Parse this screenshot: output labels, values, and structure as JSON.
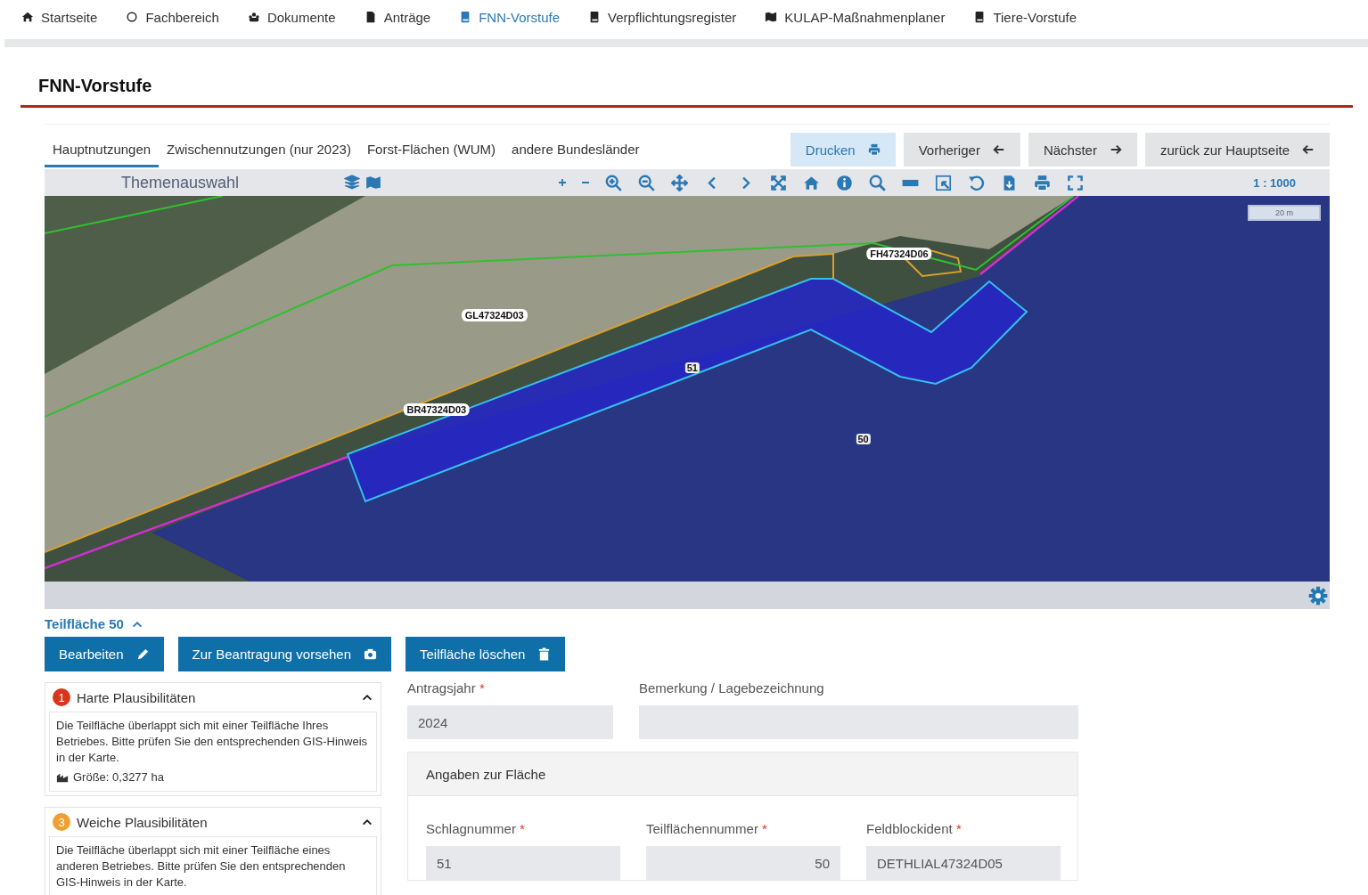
{
  "nav": [
    {
      "label": "Startseite",
      "selected": false
    },
    {
      "label": "Fachbereich",
      "selected": false
    },
    {
      "label": "Dokumente",
      "selected": false
    },
    {
      "label": "Anträge",
      "selected": false
    },
    {
      "label": "FNN-Vorstufe",
      "selected": true
    },
    {
      "label": "Verpflichtungsregister",
      "selected": false
    },
    {
      "label": "KULAP-Maßnahmenplaner",
      "selected": false
    },
    {
      "label": "Tiere-Vorstufe",
      "selected": false
    }
  ],
  "page_title": "FNN-Vorstufe",
  "tabs": [
    {
      "label": "Hauptnutzungen",
      "selected": true
    },
    {
      "label": "Zwischennutzungen (nur 2023)",
      "selected": false
    },
    {
      "label": "Forst-Flächen (WUM)",
      "selected": false
    },
    {
      "label": "andere Bundesländer",
      "selected": false
    }
  ],
  "header_buttons": [
    {
      "label": "Drucken",
      "kind": "print"
    },
    {
      "label": "Vorheriger",
      "kind": "prev"
    },
    {
      "label": "Nächster",
      "kind": "next"
    },
    {
      "label": "zurück zur Hauptseite",
      "kind": "back"
    }
  ],
  "map": {
    "theme_label": "Themenauswahl",
    "scale_ratio": "1 : 1000",
    "scale_bar": "20 m",
    "labels": [
      {
        "text": "GL47324D03",
        "kind": "field"
      },
      {
        "text": "BR47324D03",
        "kind": "field"
      },
      {
        "text": "FH47324D06",
        "kind": "field"
      },
      {
        "text": "51",
        "kind": "number"
      },
      {
        "text": "50",
        "kind": "number"
      }
    ]
  },
  "section": {
    "title": "Teilfläche 50",
    "expanded": true
  },
  "actions": [
    {
      "label": "Bearbeiten",
      "kind": "edit"
    },
    {
      "label": "Zur Beantragung vorsehen",
      "kind": "camera"
    },
    {
      "label": "Teilfläche löschen",
      "kind": "delete"
    }
  ],
  "checks": [
    {
      "count": "1",
      "title": "Harte Plausibilitäten",
      "color": "#d9351c",
      "expanded": true,
      "message": "Die Teilfläche überlappt sich mit einer Teilfläche Ihres Betriebes. Bitte prüfen Sie den entsprechenden GIS-Hinweis in der Karte.",
      "size": "Größe: 0,3277 ha"
    },
    {
      "count": "3",
      "title": "Weiche Plausibilitäten",
      "color": "#f0a030",
      "expanded": true,
      "message": "Die Teilfläche überlappt sich mit einer Teilfläche eines anderen Betriebes. Bitte prüfen Sie den entsprechenden GIS-Hinweis in der Karte."
    }
  ],
  "form": {
    "fields": [
      {
        "label": "Antragsjahr",
        "required_mark": "*",
        "value": "2024"
      },
      {
        "label": "Bemerkung / Lagebezeichnung"
      }
    ],
    "panel": {
      "title": "Angaben zur Fläche",
      "fields": [
        {
          "label": "Schlagnummer",
          "required_mark": "*",
          "value": "51"
        },
        {
          "label": "Teilflächennummer",
          "required_mark": "*",
          "value": "50",
          "kind": "number"
        },
        {
          "label": "Feldblockident",
          "required_mark": "*",
          "value": "DETHLIAL47324D05"
        }
      ]
    }
  }
}
